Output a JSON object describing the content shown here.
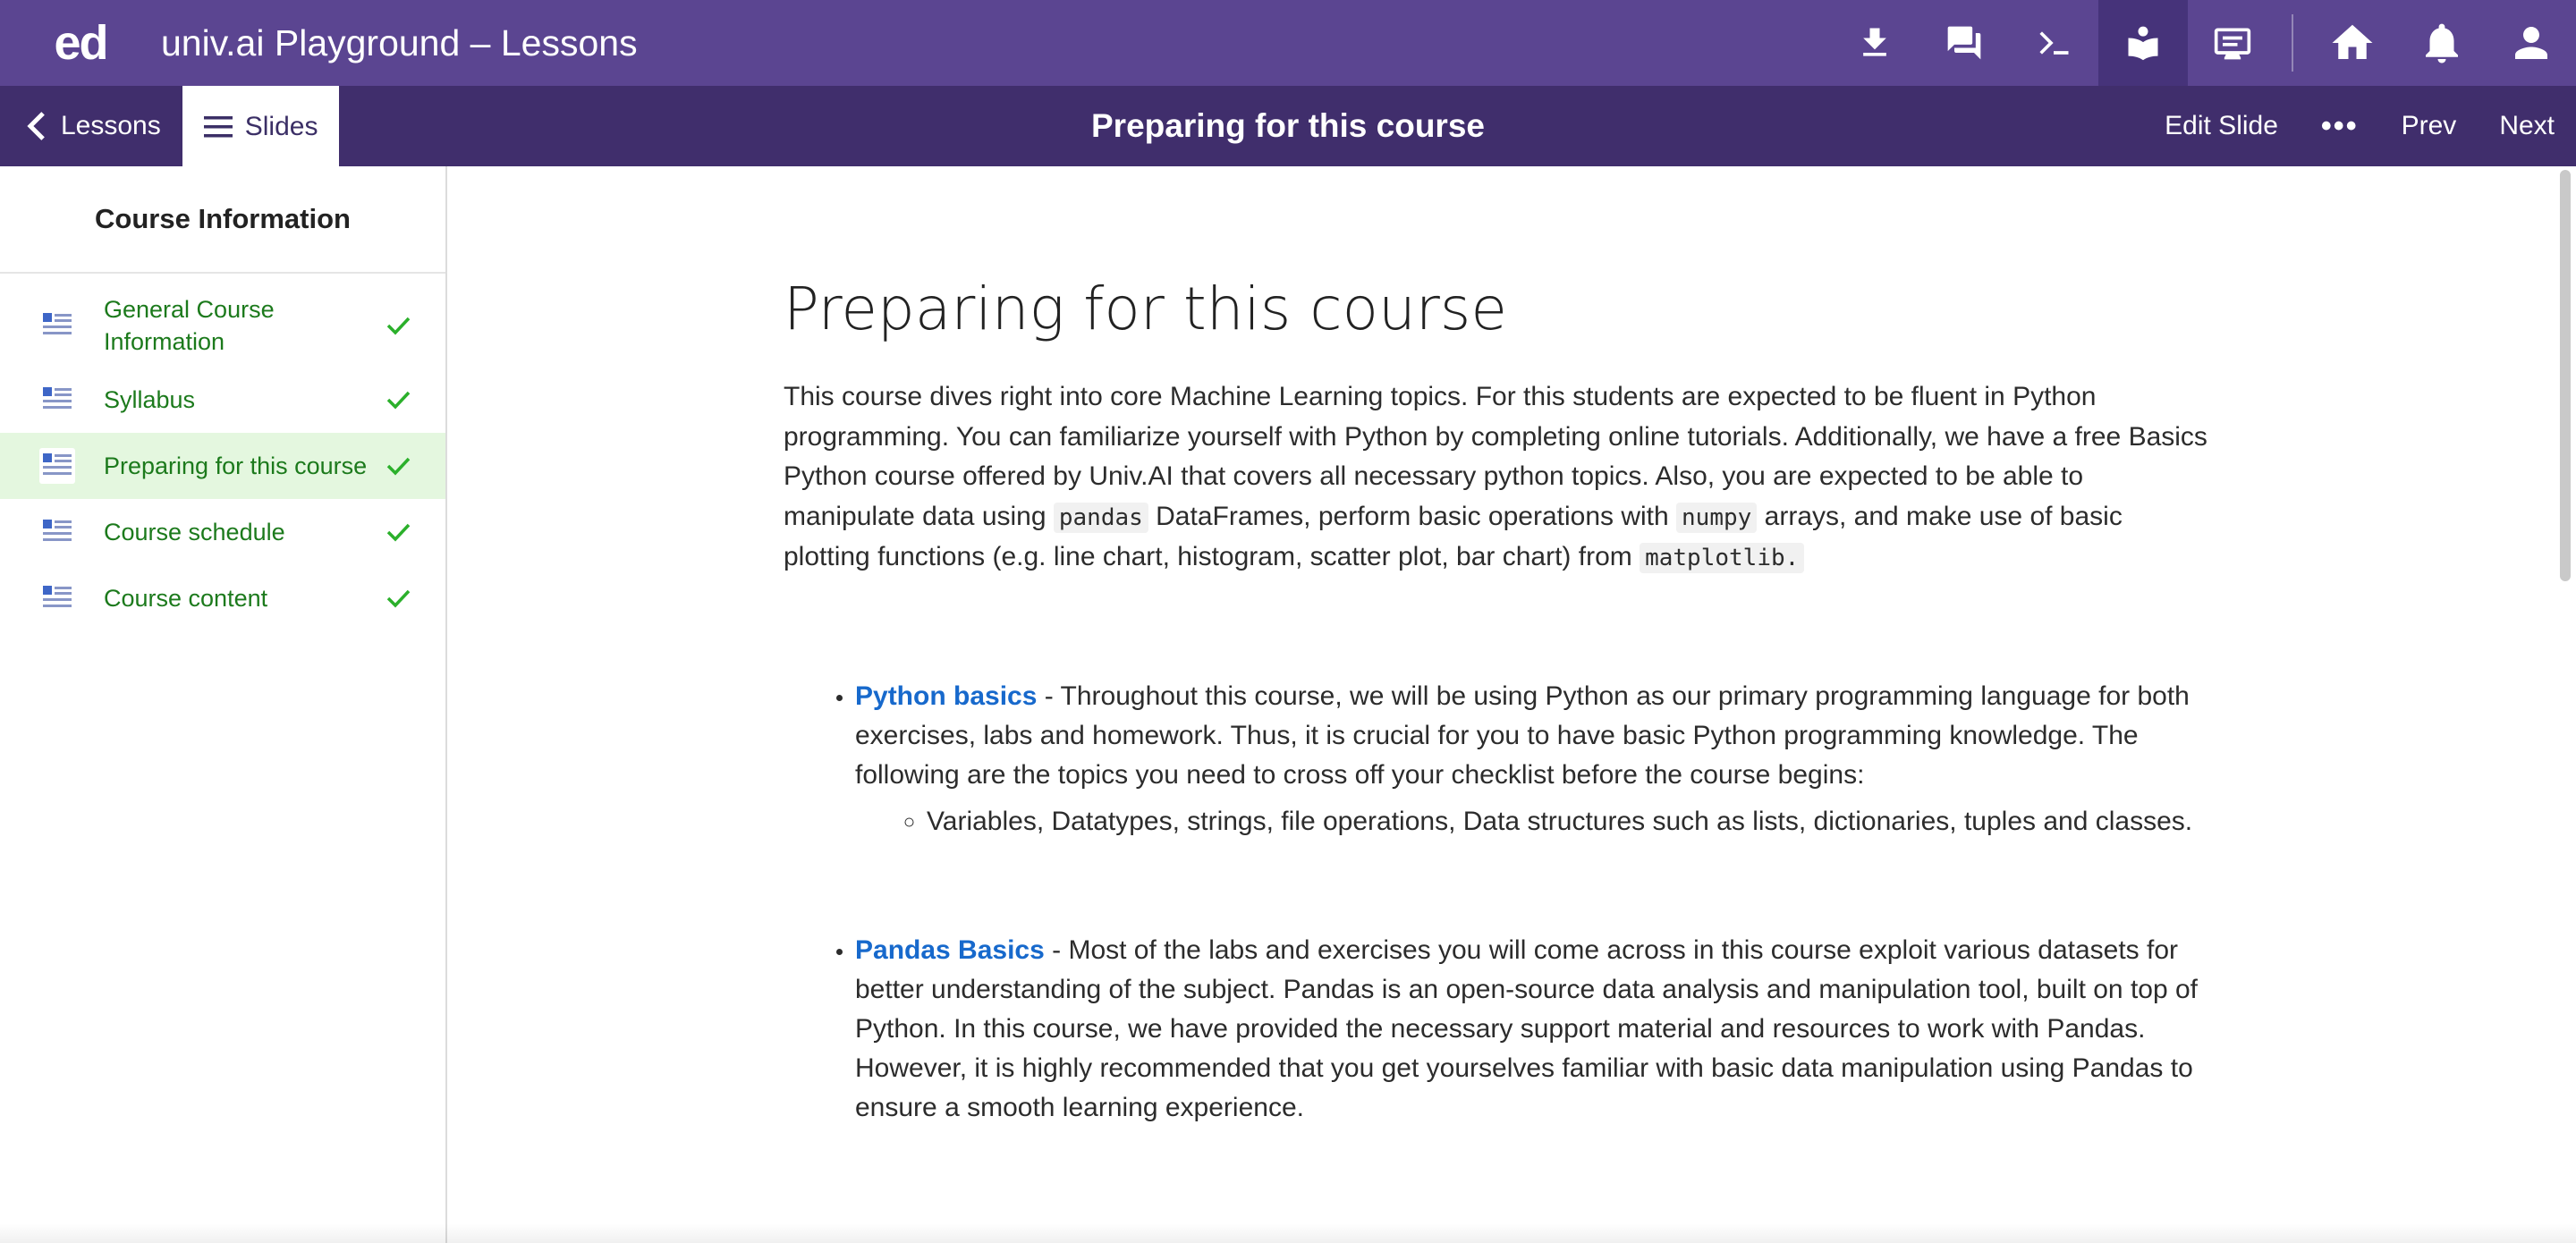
{
  "topbar": {
    "logo": "ed",
    "title": "univ.ai Playground – Lessons",
    "icons": [
      "download-icon",
      "chat-icon",
      "terminal-icon",
      "lessons-icon",
      "slides-icon",
      "home-icon",
      "bell-icon",
      "user-icon"
    ]
  },
  "subbar": {
    "back_label": "Lessons",
    "slides_label": "Slides",
    "title": "Preparing for this course",
    "edit_label": "Edit Slide",
    "more_label": "•••",
    "prev_label": "Prev",
    "next_label": "Next"
  },
  "sidebar": {
    "heading": "Course Information",
    "items": [
      {
        "label": "General Course Information",
        "done": true,
        "active": false
      },
      {
        "label": "Syllabus",
        "done": true,
        "active": false
      },
      {
        "label": "Preparing for this course",
        "done": true,
        "active": true
      },
      {
        "label": "Course schedule",
        "done": true,
        "active": false
      },
      {
        "label": "Course content",
        "done": true,
        "active": false
      }
    ]
  },
  "content": {
    "heading": "Preparing for this course",
    "intro_1": "This course dives right into core Machine Learning topics. For this students are expected to be fluent in Python programming. You can familiarize yourself with Python by completing online tutorials. Additionally, we have a free Basics Python course offered by Univ.AI that covers all necessary python topics. Also, you are expected to be able to manipulate data using ",
    "code_pandas": "pandas",
    "intro_2": " DataFrames, perform basic operations with ",
    "code_numpy": "numpy",
    "intro_3": " arrays, and make use of basic plotting functions (e.g. line chart, histogram, scatter plot, bar chart) from ",
    "code_matplotlib": "matplotlib.",
    "python": {
      "link": "Python basics",
      "text": " -  Throughout this course, we will be using Python as our primary programming language for both exercises, labs and homework. Thus, it is crucial for you to have basic Python programming knowledge. The following are the topics you need to cross off your checklist before the course begins:",
      "sub": "Variables, Datatypes, strings, file operations, Data structures such as lists, dictionaries, tuples and classes."
    },
    "pandas": {
      "link": "Pandas Basics",
      "text": " - Most of the labs and exercises you will come across in this course exploit various datasets for better understanding of the subject. Pandas is an open-source data analysis and manipulation tool, built on top of Python. In this course, we have provided the necessary support material and resources to work with Pandas. However, it is highly recommended that you get yourselves familiar with basic data manipulation using Pandas to ensure a smooth learning experience."
    }
  },
  "colors": {
    "topbar": "#5b4591",
    "subbar": "#402e6c",
    "active_item_bg": "#e4f7df",
    "sidebar_text": "#1c7a1c",
    "link": "#1769cc"
  }
}
